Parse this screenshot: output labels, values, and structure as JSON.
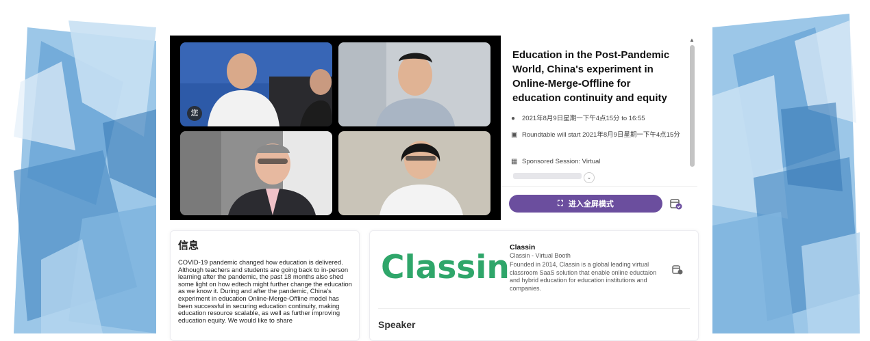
{
  "session": {
    "title": "Education in the Post-Pandemic World, China's experiment in Online-Merge-Offline for education continuity and equity",
    "datetime": "2021年8月9日星期一下午4点15分 to 16:55",
    "roundtable": "Roundtable will start 2021年8月9日星期一下午4点15分",
    "sponsored": "Sponsored Session: Virtual",
    "fullscreen_label": "进入全屏模式",
    "speaker_badge": "您"
  },
  "info": {
    "heading": "信息",
    "text": "COVID-19 pandemic changed how education is delivered. Although teachers and students are going back to in-person learning after the pandemic, the past 18 months also shed some light on how edtech might further change the education as we know it. During and after the pandemic, China's experiment in education Online-Merge-Offline model has been successful in securing education continuity, making education resource scalable, as well as further improving education equity. We would like to share"
  },
  "booth": {
    "logo_text": "Classin",
    "name": "Classin",
    "subtitle": "Classin - Virtual Booth",
    "description": "Founded in 2014, Classin is a global leading virtual classroom SaaS solution that enable online eductaion and hybrid education for education institutions and companies.",
    "speaker_heading": "Speaker"
  },
  "icons": {
    "datetime": "clock-icon",
    "roundtable": "roundtable-icon",
    "sponsored": "building-icon",
    "fullscreen": "fullscreen-icon",
    "calendar": "calendar-add-icon",
    "expand": "chevron-down-icon"
  },
  "colors": {
    "accent": "#6b4e9e",
    "brand_green": "#2fa66a",
    "video_bg": "#000000"
  }
}
